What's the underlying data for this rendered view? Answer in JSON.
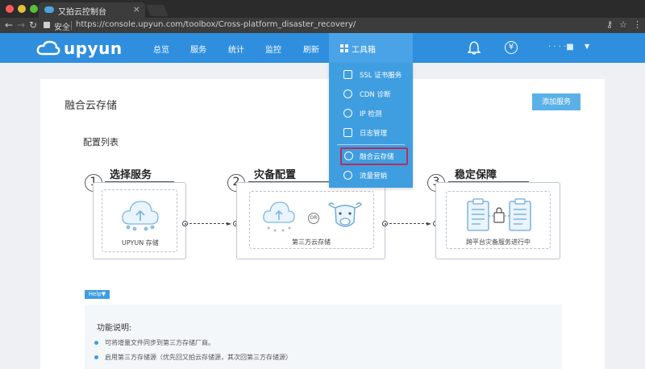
{
  "browser": {
    "tab_title": "又拍云控制台",
    "tab_close": "×",
    "secure_label": "安全",
    "url": "https://console.upyun.com/toolbox/Cross-platform_disaster_recovery/"
  },
  "header": {
    "logo": "upyun",
    "nav": [
      "总览",
      "服务",
      "统计",
      "监控",
      "刷新"
    ],
    "toolbox_label": "工具箱",
    "yen": "¥",
    "user": "· ·  ·  ·■",
    "user_caret": "▼"
  },
  "toolbox_menu": {
    "items": [
      {
        "label": "SSL 证书服务",
        "icon": "certificate-icon"
      },
      {
        "label": "CDN 诊断",
        "icon": "pulse-icon"
      },
      {
        "label": "IP 检测",
        "icon": "compass-icon"
      },
      {
        "label": "日志管理",
        "icon": "document-icon"
      },
      {
        "label": "融合云存储",
        "icon": "cloud-upload-icon",
        "selected": true
      },
      {
        "label": "流量营销",
        "icon": "pie-chart-icon"
      }
    ]
  },
  "page": {
    "title": "融合云存储",
    "add_button": "添加服务",
    "section_title": "配置列表",
    "steps": [
      {
        "number": "1",
        "title": "选择服务",
        "caption": "UPYUN 存储"
      },
      {
        "number": "2",
        "title": "灾备配置",
        "caption": "第三方云存储",
        "or_label": "OR"
      },
      {
        "number": "3",
        "title": "稳定保障",
        "caption": "跨平台灾备服务进行中"
      }
    ],
    "connector_arrow": "►"
  },
  "help": {
    "badge": "Help▼",
    "title": "功能说明:",
    "items": [
      "可将增量文件同步到第三方存储厂商。",
      "启用第三方存储源（优先回又拍云存储源，其次回第三方存储源）"
    ]
  },
  "colors": {
    "header_blue": "#2f8fde",
    "dropdown_blue": "#3f9ee0",
    "selected_outline": "#b72d5b"
  }
}
